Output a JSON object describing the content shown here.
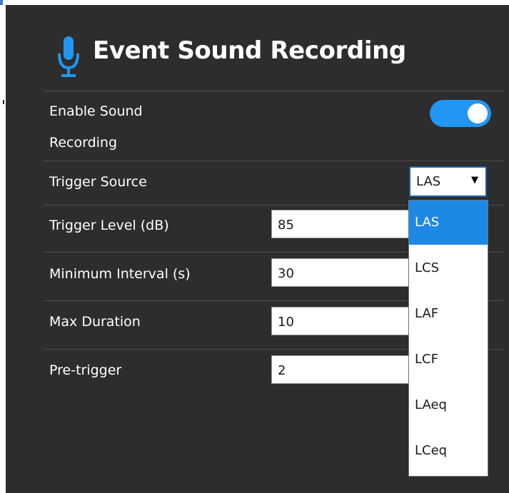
{
  "colors": {
    "panel_bg": "#2d2d2d",
    "accent": "#2196f3",
    "selected_option_bg": "#1e88e5",
    "divider": "#4d4d4d",
    "text": "#ffffff"
  },
  "header": {
    "icon": "microphone-icon",
    "title": "Event Sound Recording"
  },
  "settings": {
    "enable_sound_recording": {
      "label_line1": "Enable Sound",
      "label_line2": "Recording",
      "value": true
    },
    "trigger_source": {
      "label": "Trigger Source",
      "value": "LAS",
      "caret": "▼",
      "dropdown_open": true,
      "options": [
        "LAS",
        "LCS",
        "LAF",
        "LCF",
        "LAeq",
        "LCeq"
      ],
      "highlighted_option": "LAS"
    },
    "trigger_level": {
      "label": "Trigger Level (dB)",
      "value": "85"
    },
    "minimum_interval": {
      "label": "Minimum Interval (s)",
      "value": "30"
    },
    "max_duration": {
      "label": "Max Duration",
      "value": "10"
    },
    "pre_trigger": {
      "label": "Pre-trigger",
      "value": "2"
    }
  }
}
